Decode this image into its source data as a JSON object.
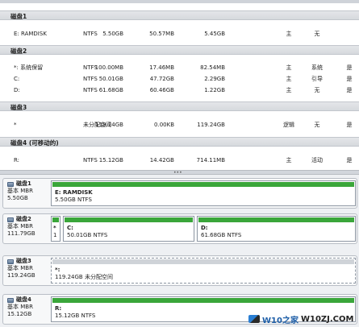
{
  "list": {
    "groups": [
      {
        "title": "磁盘1",
        "rows": [
          {
            "volume": "E: RAMDISK",
            "fs": "NTFS",
            "capacity": "5.50GB",
            "used": "50.57MB",
            "free": "5.45GB",
            "type": "主",
            "status": "无",
            "mbr": ""
          }
        ]
      },
      {
        "title": "磁盘2",
        "rows": [
          {
            "volume": "*: 系统保留",
            "fs": "NTFS",
            "capacity": "100.00MB",
            "used": "17.46MB",
            "free": "82.54MB",
            "type": "主",
            "status": "系统",
            "mbr": "是"
          },
          {
            "volume": "C:",
            "fs": "NTFS",
            "capacity": "50.01GB",
            "used": "47.72GB",
            "free": "2.29GB",
            "type": "主",
            "status": "引导",
            "mbr": "是"
          },
          {
            "volume": "D:",
            "fs": "NTFS",
            "capacity": "61.68GB",
            "used": "60.46GB",
            "free": "1.22GB",
            "type": "主",
            "status": "无",
            "mbr": "是"
          }
        ]
      },
      {
        "title": "磁盘3",
        "rows": [
          {
            "volume": "*",
            "fs": "未分配空间",
            "capacity": "119.24GB",
            "used": "0.00KB",
            "free": "119.24GB",
            "type": "逻辑",
            "status": "无",
            "mbr": "是"
          }
        ]
      },
      {
        "title": "磁盘4 (可移动的)",
        "rows": [
          {
            "volume": "R:",
            "fs": "NTFS",
            "capacity": "15.12GB",
            "used": "14.42GB",
            "free": "714.11MB",
            "type": "主",
            "status": "活动",
            "mbr": "是"
          }
        ]
      }
    ]
  },
  "splitter_grip": "•••",
  "disks": [
    {
      "name": "磁盘1",
      "kind": "基本 MBR",
      "size": "5.50GB",
      "parts": [
        {
          "label": "E: RAMDISK",
          "detail": "5.50GB NTFS",
          "bar": "green"
        }
      ]
    },
    {
      "name": "磁盘2",
      "kind": "基本 MBR",
      "size": "111.79GB",
      "parts": [
        {
          "label": "*",
          "detail": "1",
          "bar": "green"
        },
        {
          "label": "C:",
          "detail": "50.01GB NTFS",
          "bar": "green"
        },
        {
          "label": "D:",
          "detail": "61.68GB NTFS",
          "bar": "green"
        }
      ]
    },
    {
      "name": "磁盘3",
      "kind": "基本 MBR",
      "size": "119.24GB",
      "parts": [
        {
          "label": "*:",
          "detail": "119.24GB 未分配空间",
          "bar": "gray"
        }
      ]
    },
    {
      "name": "磁盘4",
      "kind": "基本 MBR",
      "size": "15.12GB",
      "parts": [
        {
          "label": "R:",
          "detail": "15.12GB NTFS",
          "bar": "green"
        }
      ]
    }
  ],
  "watermark": {
    "text1": "W10之家",
    "text2": "W10ZJ.COM"
  }
}
